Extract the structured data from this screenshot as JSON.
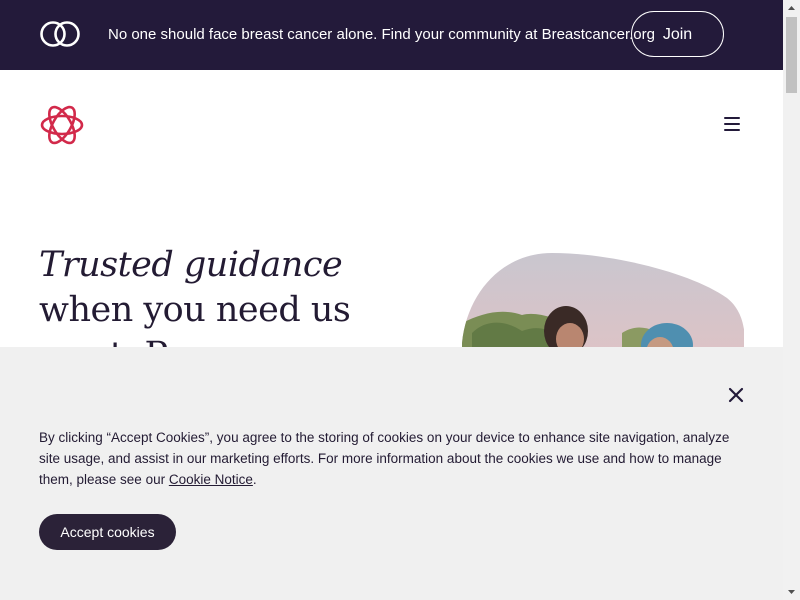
{
  "banner": {
    "logo_icon": "double-ring-icon",
    "text": "No one should face breast cancer alone. Find your community at Breastcancer.org",
    "join_label": "Join",
    "background": "#231a3a"
  },
  "header": {
    "logo_icon": "brand-knot-icon",
    "logo_color": "#d2294a",
    "menu_icon": "hamburger-menu-icon"
  },
  "hero": {
    "title_italic": "Trusted guidance",
    "title_line2": "when you need us",
    "title_line3": "most. P",
    "image_icon": "two-women-photo"
  },
  "cookie": {
    "text_before_link": "By clicking “Accept Cookies”, you agree to the storing of cookies on your device to enhance site navigation, analyze site usage, and assist in our marketing efforts. For more information about the cookies we use and how to manage them, please see our ",
    "link_text": "Cookie Notice",
    "text_after_link": ".",
    "accept_label": "Accept cookies",
    "close_icon": "close-icon",
    "background": "#f0f0f0"
  }
}
